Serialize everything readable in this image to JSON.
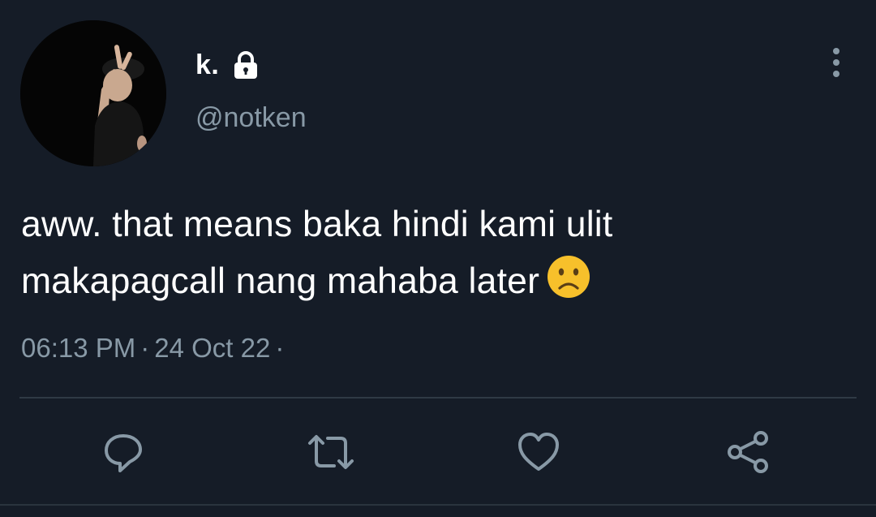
{
  "colors": {
    "background": "#151c27",
    "primary_text": "#ffffff",
    "secondary_text": "#8899a6",
    "divider": "#2f3a45",
    "emoji_yellow": "#f7c02b"
  },
  "author": {
    "display_name": "k.",
    "handle": "@notken",
    "protected_icon": "lock-icon",
    "avatar_icon": "avatar"
  },
  "tweet": {
    "line1": "aww. that means baka hindi kami ulit",
    "line2": "makapagcall nang mahaba later",
    "emoji": "frowning-face-emoji"
  },
  "meta": {
    "time": "06:13 PM",
    "separator": "·",
    "date": "24 Oct 22",
    "trailing_separator": "·"
  },
  "actions": [
    {
      "name": "reply",
      "icon": "reply-icon"
    },
    {
      "name": "retweet",
      "icon": "retweet-icon"
    },
    {
      "name": "like",
      "icon": "heart-icon"
    },
    {
      "name": "share",
      "icon": "share-icon"
    }
  ],
  "menu": {
    "icon": "more-options-icon"
  }
}
